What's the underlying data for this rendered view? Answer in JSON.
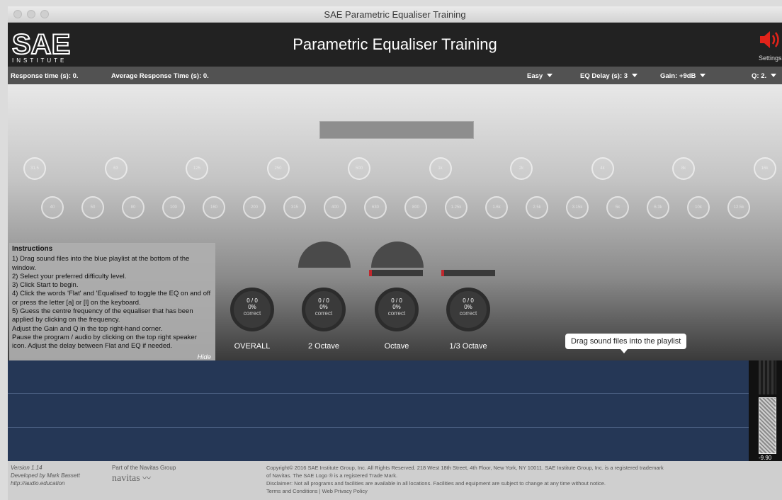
{
  "window": {
    "title": "SAE Parametric Equaliser Training"
  },
  "header": {
    "logo_text": "SAE",
    "logo_subtext": "INSTITUTE",
    "title": "Parametric Equaliser Training",
    "settings_label": "Settings"
  },
  "status": {
    "response_time": "Response time (s): 0.",
    "avg_response_time": "Average Response Time (s): 0.",
    "difficulty": "Easy",
    "eq_delay": "EQ Delay (s): 3",
    "gain": "Gain: +9dB",
    "q": "Q: 2."
  },
  "instructions": {
    "heading": "Instructions",
    "text": "1) Drag sound files into the blue playlist at the bottom of the window.\n2) Select your preferred difficulty level.\n3) Click Start to begin.\n4) Click the words 'Flat' and 'Equalised' to toggle the EQ on and off or press the letter [a] or [l] on the keyboard.\n5) Guess the centre frequency of the equaliser that has been applied by clicking on the frequency.\nAdjust the Gain and Q in the top right-hand corner.\nPause the program / audio by clicking on the top right speaker icon. Adjust the delay between Flat and EQ if needed.",
    "hide": "Hide"
  },
  "freq_row1": [
    "31.5",
    "63",
    "125",
    "250",
    "500",
    "1k",
    "2k",
    "4k",
    "8k",
    "16k"
  ],
  "freq_row2": [
    "40",
    "50",
    "80",
    "100",
    "160",
    "200",
    "315",
    "400",
    "630",
    "800",
    "1.25k",
    "1.6k",
    "2.5k",
    "3.15k",
    "5k",
    "6.3k",
    "10k",
    "12.5k"
  ],
  "stats": [
    {
      "score": "0 / 0",
      "percent": "0%",
      "word": "correct",
      "label": "OVERALL"
    },
    {
      "score": "0 / 0",
      "percent": "0%",
      "word": "correct",
      "label": "2 Octave"
    },
    {
      "score": "0 / 0",
      "percent": "0%",
      "word": "correct",
      "label": "Octave"
    },
    {
      "score": "0 / 0",
      "percent": "0%",
      "word": "correct",
      "label": "1/3 Octave"
    }
  ],
  "playlist": {
    "tooltip": "Drag sound files into the playlist"
  },
  "meter": {
    "value": "-9.90"
  },
  "footer": {
    "version": "Version 1.14",
    "developer": "Developed by Mark Bassett",
    "website": "http://audio.education",
    "group": "Part of the Navitas Group",
    "brand": "navitas",
    "copyright": "Copyright© 2016 SAE Institute Group, Inc. All Rights Reserved. 218 West 18th Street, 4th Floor, New York, NY 10011. SAE Institute Group, Inc. is a registered trademark",
    "copyright2": "of Navitas. The SAE Logo ® is a registered Trade Mark.",
    "disclaimer": "Disclaimer: Not all programs and facilities are available in all locations. Facilities and equipment are subject to change at any time without notice.",
    "links": "Terms and Conditions | Web Privacy Policy"
  },
  "colors": {
    "header": "#222222",
    "statusbar": "#525252",
    "playlist": "#253756",
    "accent_red": "#c0272d"
  }
}
